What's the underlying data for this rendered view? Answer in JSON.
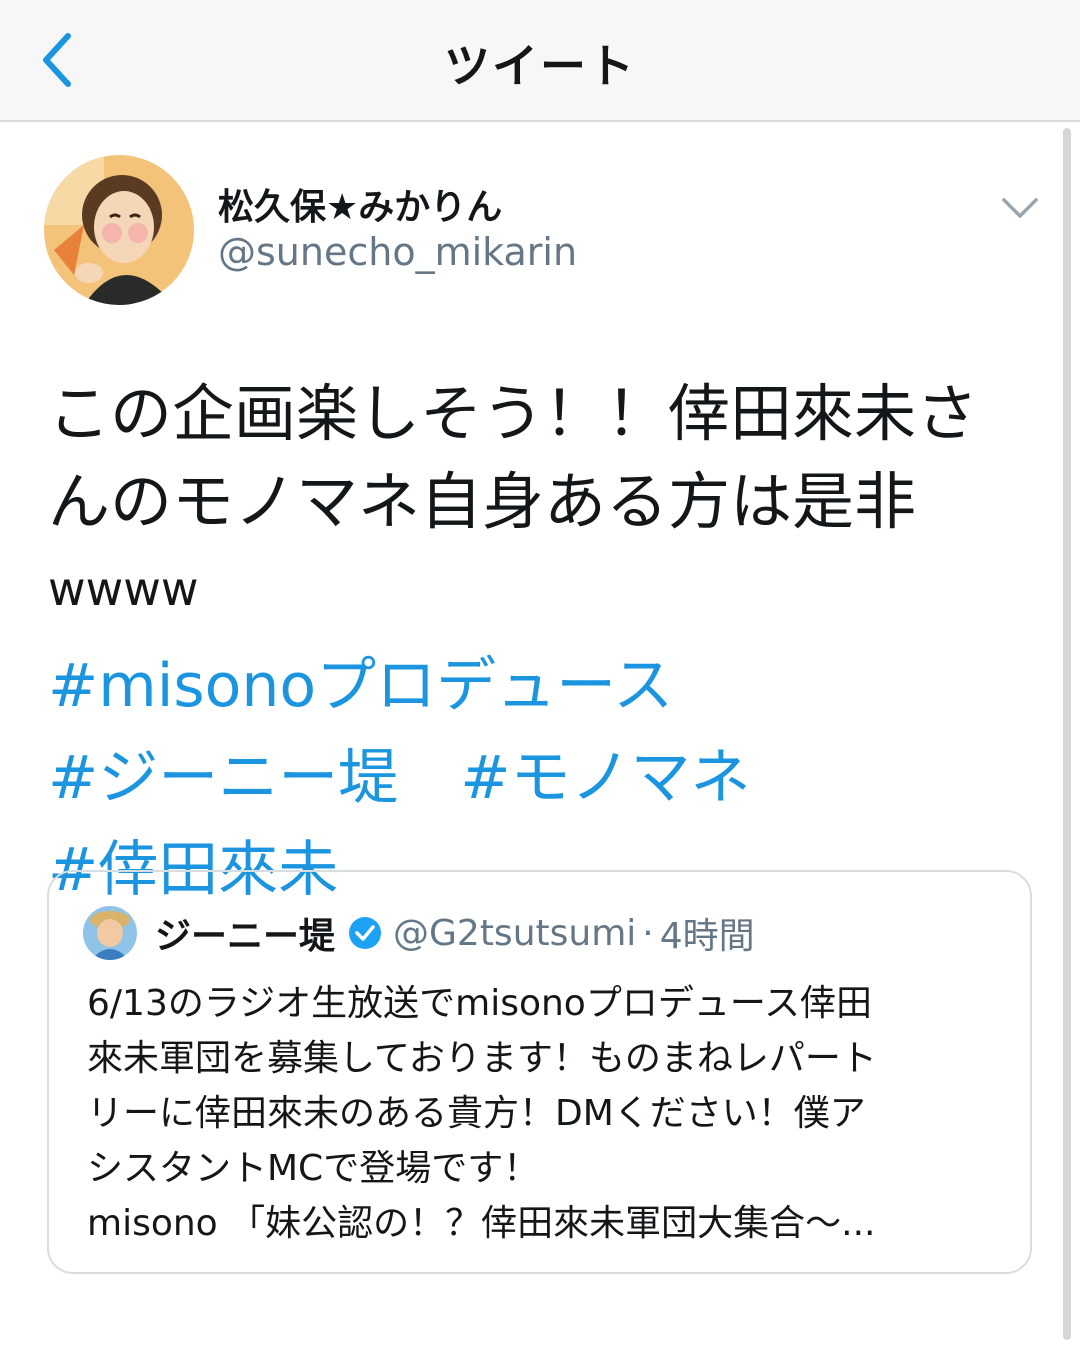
{
  "header": {
    "title": "ツイート",
    "back_icon": "chevron-left-icon"
  },
  "colors": {
    "link": "#1b95e0",
    "text": "#14171a",
    "muted": "#657786",
    "verified": "#1da1f2"
  },
  "tweet": {
    "author_name": "松久保★みかりん",
    "author_handle": "@sunecho_mikarin",
    "text": "この企画楽しそう！！倖田來未さんのモノマネ自身ある方は是非",
    "text_suffix": "wwww",
    "hashtags": [
      "#misonoプロデュース",
      "#ジーニー堤",
      "#モノマネ",
      "#倖田來未"
    ]
  },
  "quoted_tweet": {
    "author_name": "ジーニー堤",
    "author_handle": "@G2tsutsumi",
    "separator": "·",
    "time": "4時間",
    "verified_icon": "verified-badge-icon",
    "lines": [
      "6/13のラジオ生放送でmisonoプロデュース倖田",
      "來未軍団を募集しております！ものまねレパート",
      "リーに倖田來未のある貴方！DMください！僕ア",
      "シスタントMCで登場です！",
      "misono 「妹公認の！？倖田來未軍団大集合〜..."
    ]
  }
}
